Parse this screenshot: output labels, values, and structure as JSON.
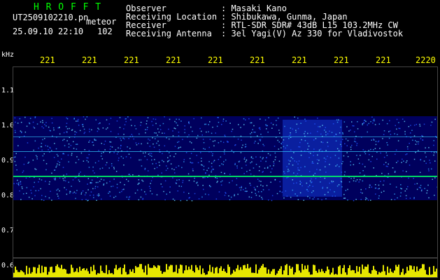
{
  "header": {
    "title": "H R O F F T",
    "filename": "UT2509102210.pn",
    "tag": "meteor",
    "datetime": "25.09.10 22:10",
    "count": "102",
    "fields": [
      {
        "label": "Observer",
        "value": ": Masaki Kano"
      },
      {
        "label": "Receiving Location",
        "value": ": Shibukawa, Gunma, Japan"
      },
      {
        "label": "Receiver",
        "value": ": RTL-SDR SDR# 43dB L15 103.2MHz CW"
      },
      {
        "label": "Receiving Antenna",
        "value": ": 3el Yagi(V) Az 330 for Vladivostok"
      }
    ]
  },
  "axes": {
    "y_unit": "kHz",
    "x_ticks": [
      "221",
      "221",
      "221",
      "221",
      "221",
      "221",
      "221",
      "221",
      "221",
      "2220"
    ],
    "y_ticks": [
      "1.1",
      "1.0",
      "0.9",
      "0.8",
      "0.7",
      "0.6"
    ]
  },
  "colors": {
    "background": "#000000",
    "title": "#00ff00",
    "ticks": "#ffff00",
    "spectrum": "#0000aa",
    "line": "#00ff66"
  }
}
